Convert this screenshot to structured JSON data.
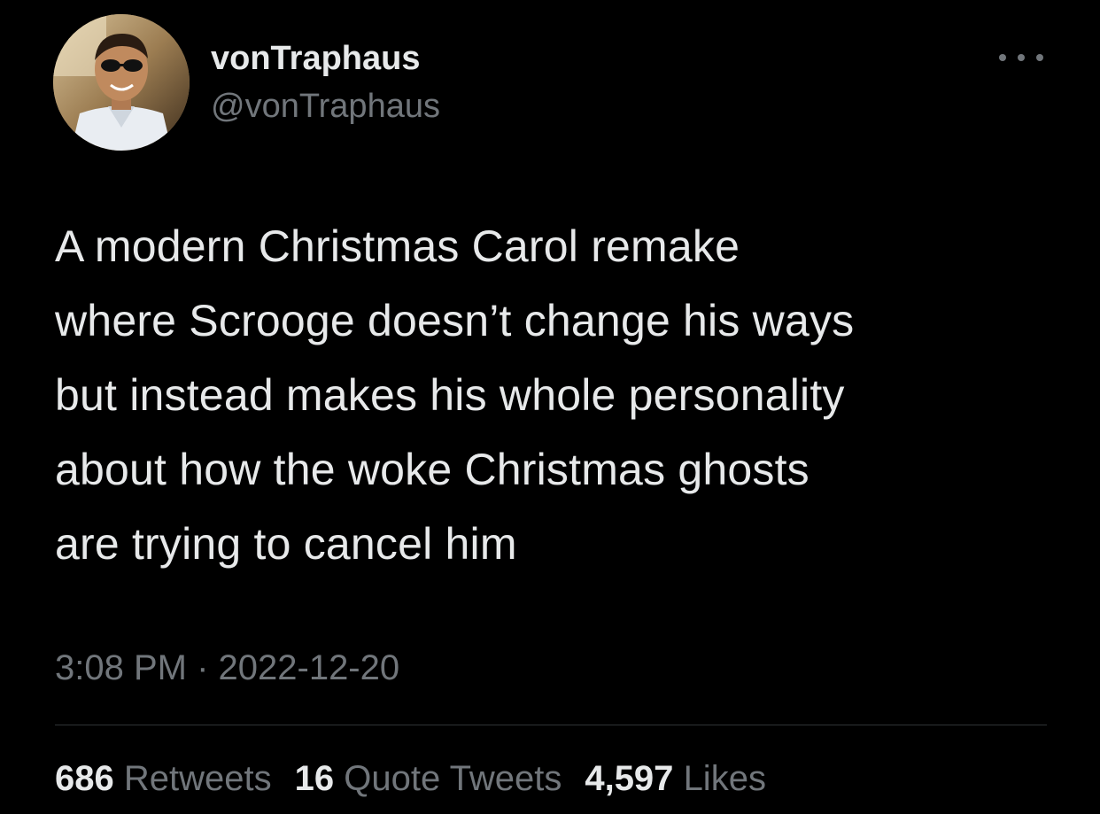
{
  "author": {
    "display_name": "vonTraphaus",
    "handle": "@vonTraphaus",
    "avatar_icon": "profile-photo"
  },
  "menu": {
    "icon": "more-horizontal-icon"
  },
  "tweet": {
    "lines": [
      "A modern Christmas Carol remake",
      "where Scrooge doesn’t change his ways",
      "but instead makes his whole personality",
      "about how the woke Christmas ghosts",
      "are trying to cancel him"
    ],
    "timestamp": "3:08 PM · 2022-12-20"
  },
  "stats": {
    "retweets": {
      "count": "686",
      "label": "Retweets"
    },
    "quote_tweets": {
      "count": "16",
      "label": "Quote Tweets"
    },
    "likes": {
      "count": "4,597",
      "label": "Likes"
    }
  },
  "colors": {
    "background": "#000000",
    "primary_text": "#e7e9ea",
    "secondary_text": "#71767b",
    "divider": "#2f3336"
  }
}
